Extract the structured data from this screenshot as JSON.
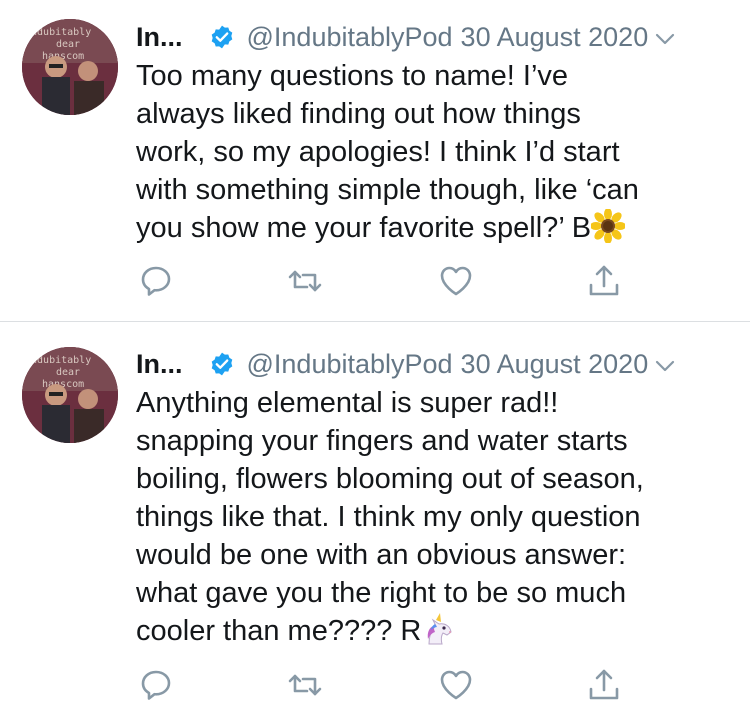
{
  "tweets": [
    {
      "display_name": "In...",
      "handle": "@IndubitablyPod",
      "date": "30 August 2020",
      "avatar_text": [
        "indubitably",
        "dear",
        "hanscom"
      ],
      "lines": [
        "Too many questions to name! I’ve",
        "always liked finding out how things",
        "work, so my apologies! I think I’d start",
        "with something simple though, like ‘can",
        "you show me your favorite spell?’ B"
      ],
      "end_emoji": "sunflower-emoji"
    },
    {
      "display_name": "In...",
      "handle": "@IndubitablyPod",
      "date": "30 August 2020",
      "avatar_text": [
        "indubitably",
        "dear",
        "hanscom"
      ],
      "lines": [
        "Anything elemental is super rad!!",
        "snapping your fingers and water starts",
        "boiling, flowers blooming out of season,",
        "things like that. I think my only question",
        "would be one with an obvious answer:",
        "what gave you the right to be so much",
        "cooler than me???? R"
      ],
      "end_emoji": "unicorn-emoji"
    }
  ],
  "colors": {
    "text": "#14171a",
    "secondary": "#657786",
    "verified": "#1da1f2",
    "divider": "#dcdfe2",
    "icon": "#8899a6"
  },
  "icons": [
    "verified-badge-icon",
    "chevron-down-icon",
    "reply-icon",
    "retweet-icon",
    "like-icon",
    "share-icon"
  ]
}
